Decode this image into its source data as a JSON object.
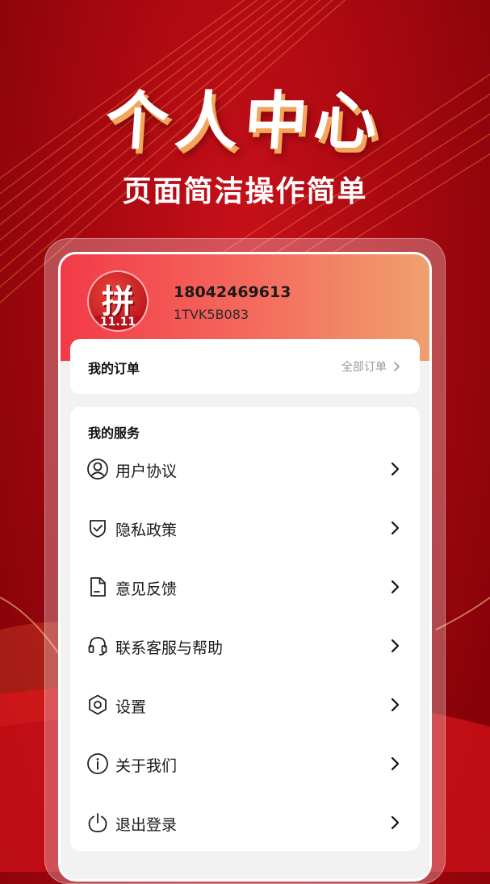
{
  "promo": {
    "title": "个人中心",
    "subtitle": "页面简洁操作简单"
  },
  "profile": {
    "avatar_glyph": "拼",
    "avatar_badge": "11.11",
    "phone": "18042469613",
    "user_id": "1TVK5B083"
  },
  "orders": {
    "title": "我的订单",
    "all_orders_label": "全部订单"
  },
  "services": {
    "title": "我的服务",
    "items": [
      {
        "label": "用户协议",
        "icon": "user-circle-icon"
      },
      {
        "label": "隐私政策",
        "icon": "shield-check-icon"
      },
      {
        "label": "意见反馈",
        "icon": "document-icon"
      },
      {
        "label": "联系客服与帮助",
        "icon": "headset-icon"
      },
      {
        "label": "设置",
        "icon": "hexagon-gear-icon"
      },
      {
        "label": "关于我们",
        "icon": "info-icon"
      },
      {
        "label": "退出登录",
        "icon": "power-icon"
      }
    ]
  },
  "colors": {
    "background": "#b00a12",
    "header_gradient_start": "#f33a48",
    "header_gradient_end": "#f0a06e",
    "promo_shadow": "#f2a65a"
  }
}
